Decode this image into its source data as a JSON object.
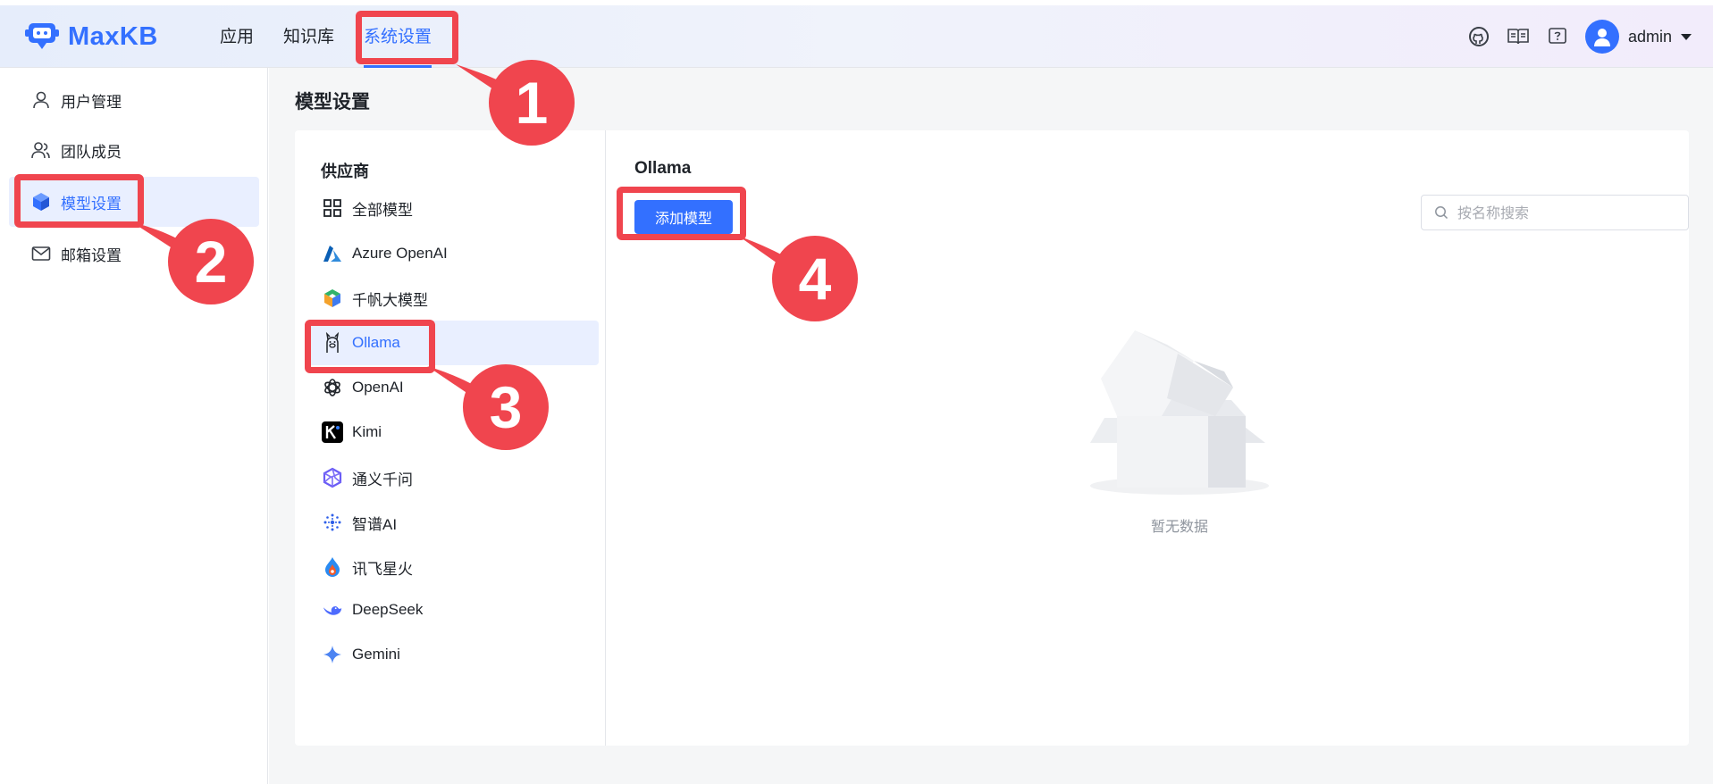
{
  "app": {
    "name": "MaxKB"
  },
  "nav": {
    "items": [
      {
        "label": "应用",
        "active": false
      },
      {
        "label": "知识库",
        "active": false
      },
      {
        "label": "系统设置",
        "active": true
      }
    ]
  },
  "header_right": {
    "icons": [
      "github-icon",
      "book-icon",
      "help-icon"
    ],
    "user": "admin"
  },
  "sidebar": {
    "items": [
      {
        "label": "用户管理",
        "icon": "user-icon",
        "active": false
      },
      {
        "label": "团队成员",
        "icon": "team-icon",
        "active": false
      },
      {
        "label": "模型设置",
        "icon": "cube-icon",
        "active": true
      },
      {
        "label": "邮箱设置",
        "icon": "mail-icon",
        "active": false
      }
    ]
  },
  "page": {
    "title": "模型设置"
  },
  "providers": {
    "heading": "供应商",
    "items": [
      {
        "label": "全部模型",
        "icon": "grid-icon"
      },
      {
        "label": "Azure OpenAI",
        "icon": "azure-icon"
      },
      {
        "label": "千帆大模型",
        "icon": "qianfan-icon"
      },
      {
        "label": "Ollama",
        "icon": "ollama-icon",
        "active": true
      },
      {
        "label": "OpenAI",
        "icon": "openai-icon"
      },
      {
        "label": "Kimi",
        "icon": "kimi-icon"
      },
      {
        "label": "通义千问",
        "icon": "tongyi-icon"
      },
      {
        "label": "智谱AI",
        "icon": "zhipu-icon"
      },
      {
        "label": "讯飞星火",
        "icon": "xunfei-icon"
      },
      {
        "label": "DeepSeek",
        "icon": "deepseek-icon"
      },
      {
        "label": "Gemini",
        "icon": "gemini-icon"
      }
    ]
  },
  "detail": {
    "title": "Ollama",
    "add_button": "添加模型",
    "search_placeholder": "按名称搜索",
    "empty_text": "暂无数据"
  },
  "callouts": [
    "1",
    "2",
    "3",
    "4"
  ],
  "colors": {
    "accent": "#3370ff",
    "callout": "#f0454e"
  }
}
